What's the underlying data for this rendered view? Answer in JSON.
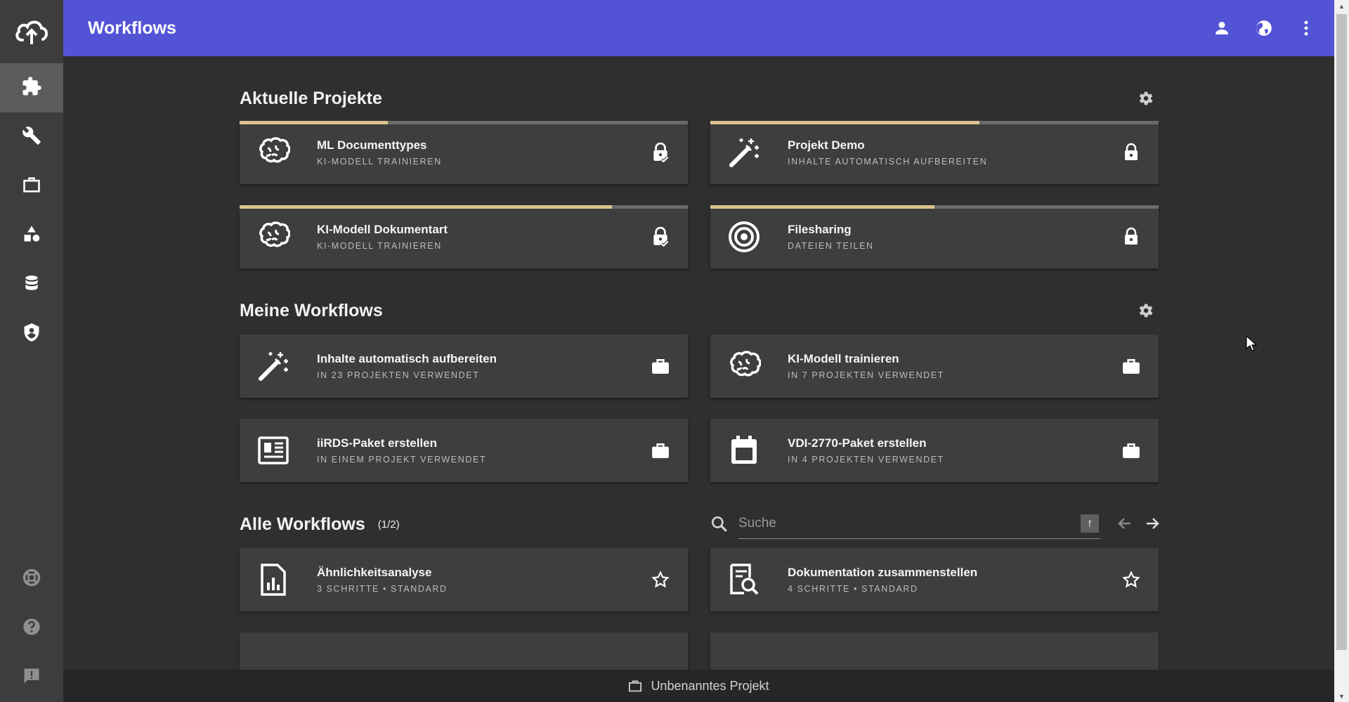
{
  "header": {
    "title": "Workflows"
  },
  "sections": {
    "current_projects": {
      "title": "Aktuelle Projekte"
    },
    "my_workflows": {
      "title": "Meine Workflows"
    },
    "all_workflows": {
      "title": "Alle Workflows",
      "count": "(1/2)"
    }
  },
  "current_projects": [
    {
      "title": "ML Documenttypes",
      "subtitle": "KI-MODELL TRAINIEREN",
      "icon": "brain-icon",
      "action_icon": "lock-check-icon",
      "progress": 0.33
    },
    {
      "title": "Projekt Demo",
      "subtitle": "INHALTE AUTOMATISCH AUFBEREITEN",
      "icon": "magic-wand-icon",
      "action_icon": "lock-icon",
      "progress": 0.6
    },
    {
      "title": "KI-Modell Dokumentart",
      "subtitle": "KI-MODELL TRAINIEREN",
      "icon": "brain-icon",
      "action_icon": "lock-check-icon",
      "progress": 0.83
    },
    {
      "title": "Filesharing",
      "subtitle": "DATEIEN TEILEN",
      "icon": "target-icon",
      "action_icon": "lock-icon",
      "progress": 0.5
    }
  ],
  "my_workflows": [
    {
      "title": "Inhalte automatisch aufbereiten",
      "subtitle": "IN 23 PROJEKTEN VERWENDET",
      "icon": "magic-wand-icon",
      "action_icon": "briefcase-icon"
    },
    {
      "title": "KI-Modell trainieren",
      "subtitle": "IN 7 PROJEKTEN VERWENDET",
      "icon": "brain-icon",
      "action_icon": "briefcase-icon"
    },
    {
      "title": "iiRDS-Paket erstellen",
      "subtitle": "IN EINEM PROJEKT VERWENDET",
      "icon": "newspaper-icon",
      "action_icon": "briefcase-icon"
    },
    {
      "title": "VDI-2770-Paket erstellen",
      "subtitle": "IN 4 PROJEKTEN VERWENDET",
      "icon": "calendar-package-icon",
      "action_icon": "briefcase-icon"
    }
  ],
  "all_workflows": [
    {
      "title": "Ähnlichkeitsanalyse",
      "subtitle": "3 SCHRITTE • STANDARD",
      "icon": "chart-document-icon",
      "action_icon": "star-outline-icon"
    },
    {
      "title": "Dokumentation zusammenstellen",
      "subtitle": "4 SCHRITTE • STANDARD",
      "icon": "document-search-icon",
      "action_icon": "star-outline-icon"
    }
  ],
  "search": {
    "placeholder": "Suche",
    "filter_label": "f"
  },
  "footer": {
    "project_label": "Unbenanntes Projekt"
  },
  "colors": {
    "topbar": "#5353d6",
    "accent_progress": "#d9c48d",
    "background": "#2f2f2f",
    "card": "#3e3e3e"
  }
}
